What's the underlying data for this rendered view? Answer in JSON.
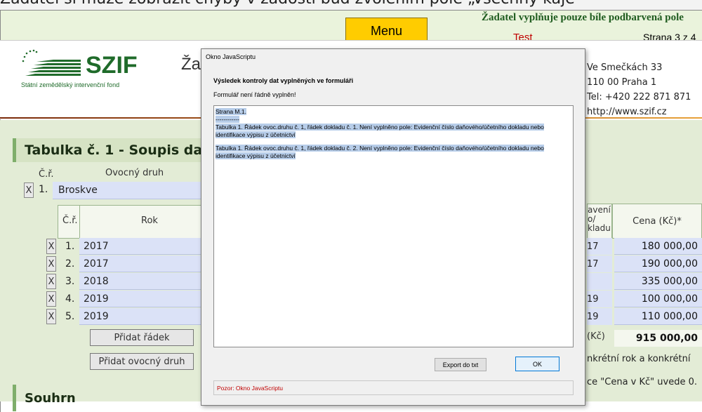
{
  "top_note": "Žadatel si může zobrazit chyby v žádosti buď zvolením pole „Všechny kaje",
  "toolbar": {
    "menu_label": "Menu",
    "applicant_note": "Žadatel vyplňuje pouze bíle podbarvená pole",
    "test_label": "Test",
    "page_label": "Strana 3 z 4"
  },
  "header": {
    "logo_text": "SZIF",
    "logo_subtitle": "Státní zemědělský intervenční fond",
    "title_fragment": "Ža",
    "address": [
      "Ve Smečkách 33",
      "110 00 Praha 1",
      "Tel: +420 222 871 871",
      "http://www.szif.cz"
    ]
  },
  "table1": {
    "title": "Tabulka č. 1  - Soupis daň",
    "col_num": "Č.ř.",
    "col_fruit": "Ovocný druh",
    "fruit_num": "1.",
    "fruit": "Broskve",
    "inner_col_num": "Č.ř.",
    "inner_col_year": "Rok",
    "remove_label": "X",
    "rows": [
      {
        "num": "1.",
        "year": "2017",
        "partial": "17",
        "price": "180 000,00"
      },
      {
        "num": "2.",
        "year": "2017",
        "partial": "17",
        "price": "190 000,00"
      },
      {
        "num": "3.",
        "year": "2018",
        "partial": "",
        "price": "335 000,00"
      },
      {
        "num": "4.",
        "year": "2019",
        "partial": "19",
        "price": "100 000,00"
      },
      {
        "num": "5.",
        "year": "2019",
        "partial": "19",
        "price": "110 000,00"
      }
    ],
    "add_row_label": "Přidat řádek",
    "add_fruit_label": "Přidat ovocný druh",
    "right_header_partial": "avení o/ kladu",
    "price_header": "Cena (Kč)*",
    "total_label": "(Kč)",
    "total": "915 000,00",
    "note1": "nkrétní rok a konkrétní",
    "note2": "ce \"Cena v Kč\" uvede 0."
  },
  "summary_title": "Souhrn",
  "dialog": {
    "title": "Okno JavaScriptu",
    "heading": "Výsledek kontroly dat vyplněných ve formuláři",
    "subheading": "Formulář není řádně vyplněn!",
    "line1": "Strana M.1.",
    "line2": "------------",
    "message1": "Tabulka 1. Řádek ovoc.druhu č. 1, řádek dokladu č. 1. Není vyplněno pole: Evidenční číslo daňového/účetního dokladu nebo identifikace výpisu z účetnictví",
    "message2": "Tabulka 1. Řádek ovoc.druhu č. 1, řádek dokladu č. 2. Není vyplněno pole: Evidenční číslo daňového/účetního dokladu nebo identifikace výpisu z účetnictví",
    "export_label": "Export do txt",
    "ok_label": "OK",
    "footer": "Pozor: Okno JavaScriptu"
  }
}
